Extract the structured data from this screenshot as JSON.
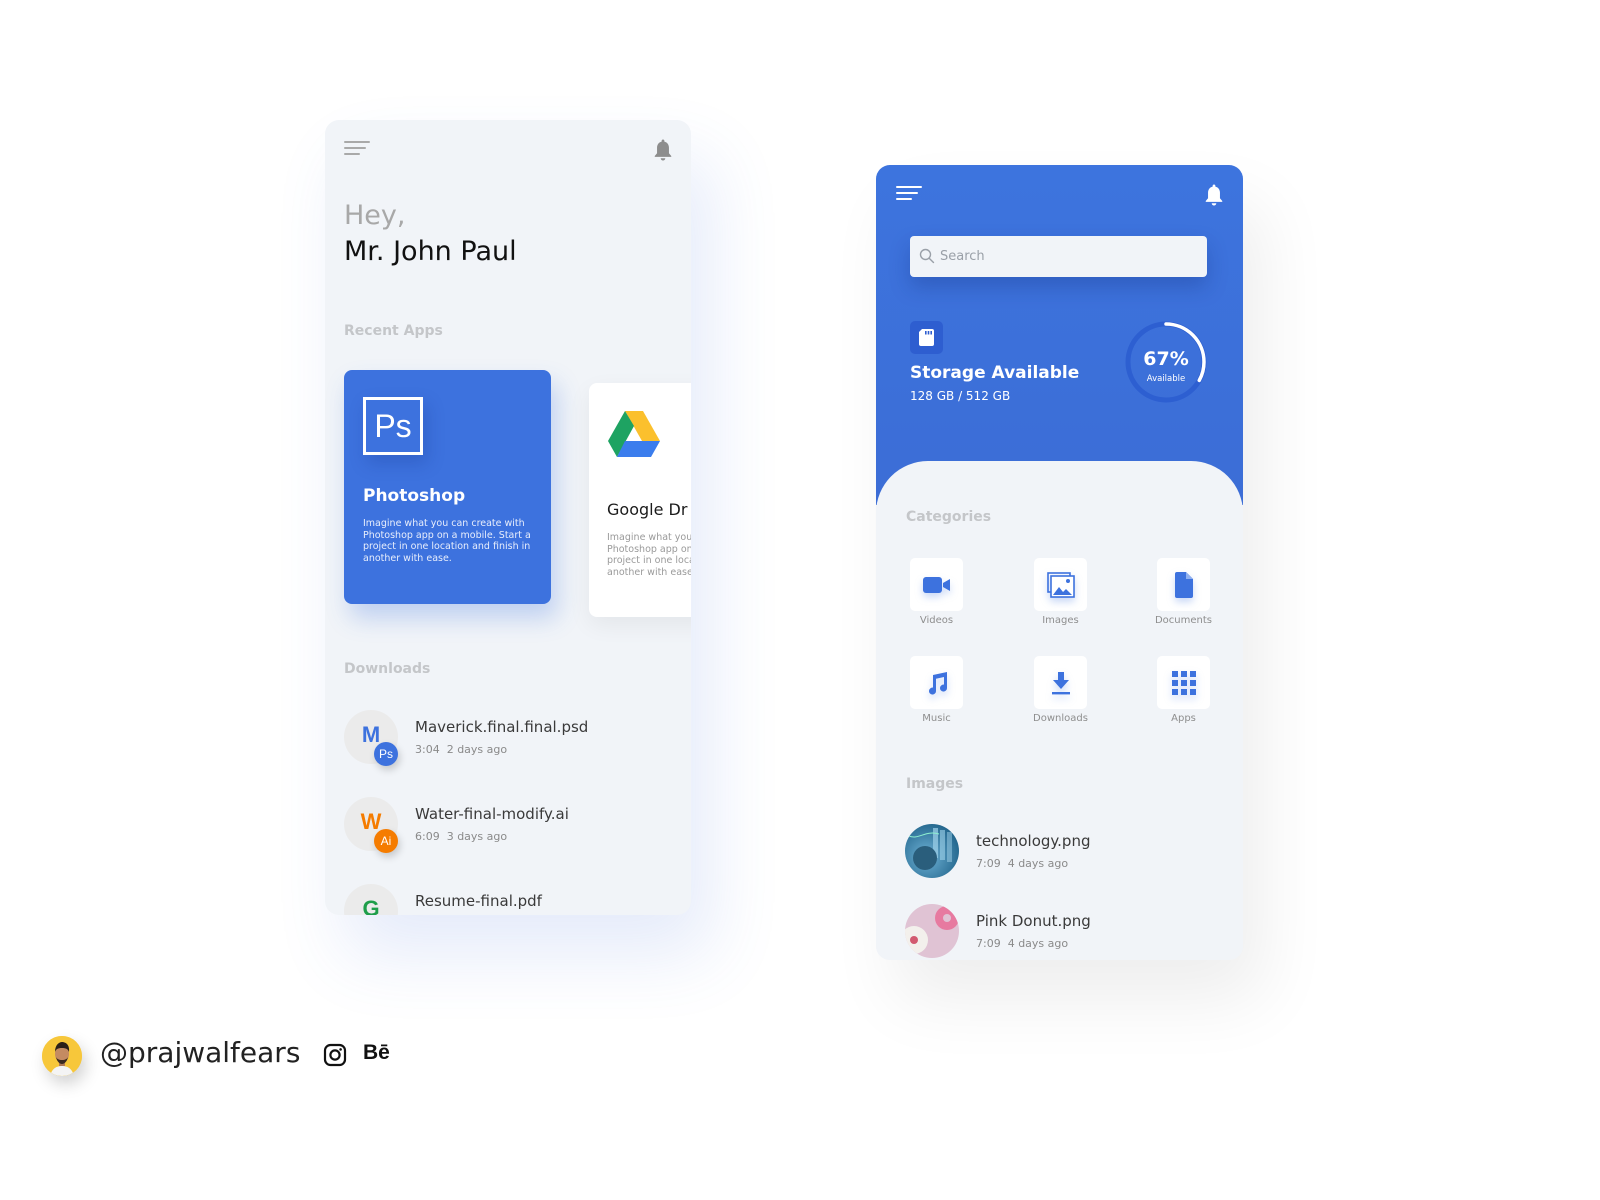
{
  "left_screen": {
    "greeting": "Hey,",
    "user_name": "Mr. John Paul",
    "recent_apps_label": "Recent Apps",
    "recent_apps": [
      {
        "name": "Photoshop",
        "logo_text": "Ps",
        "description": "Imagine what you can create with Photoshop app on a mobile. Start a project in one location and finish in another with ease.",
        "card_color": "#3d72de"
      },
      {
        "name": "Google Drive",
        "visible_name": "Google Dr",
        "description": "Imagine what you can create with Photoshop app on a mobile. Start a project in one location and finish in another with ease."
      }
    ],
    "downloads_label": "Downloads",
    "downloads": [
      {
        "letter": "M",
        "badge": "Ps",
        "name": "Maverick.final.final.psd",
        "time": "3:04",
        "age": "2 days ago",
        "color": "#3d72de"
      },
      {
        "letter": "W",
        "badge": "Ai",
        "name": "Water-final-modify.ai",
        "time": "6:09",
        "age": "3 days ago",
        "color": "#f57c00"
      },
      {
        "letter": "G",
        "badge": "",
        "name": "Resume-final.pdf",
        "time": "",
        "age": "",
        "color": "#1e9e4a"
      }
    ]
  },
  "right_screen": {
    "search_placeholder": "Search",
    "storage": {
      "title": "Storage Available",
      "used_label": "128 GB / 512 GB",
      "percent_text": "67%",
      "percent_label": "Available",
      "ring_fill_fraction": 0.33
    },
    "categories_label": "Categories",
    "categories": [
      {
        "label": "Videos",
        "icon": "video-camera-icon"
      },
      {
        "label": "Images",
        "icon": "images-icon"
      },
      {
        "label": "Documents",
        "icon": "document-icon"
      },
      {
        "label": "Music",
        "icon": "music-note-icon"
      },
      {
        "label": "Downloads",
        "icon": "download-icon"
      },
      {
        "label": "Apps",
        "icon": "apps-grid-icon"
      }
    ],
    "images_label": "Images",
    "images": [
      {
        "name": "technology.png",
        "time": "7:09",
        "age": "4 days ago"
      },
      {
        "name": "Pink Donut.png",
        "time": "7:09",
        "age": "4 days ago"
      }
    ]
  },
  "footer": {
    "handle": "@prajwalfears",
    "behance_label": "Bē"
  },
  "colors": {
    "accent": "#3d72de",
    "background_light": "#f1f4f8",
    "label_gray": "#c4c6c9"
  }
}
